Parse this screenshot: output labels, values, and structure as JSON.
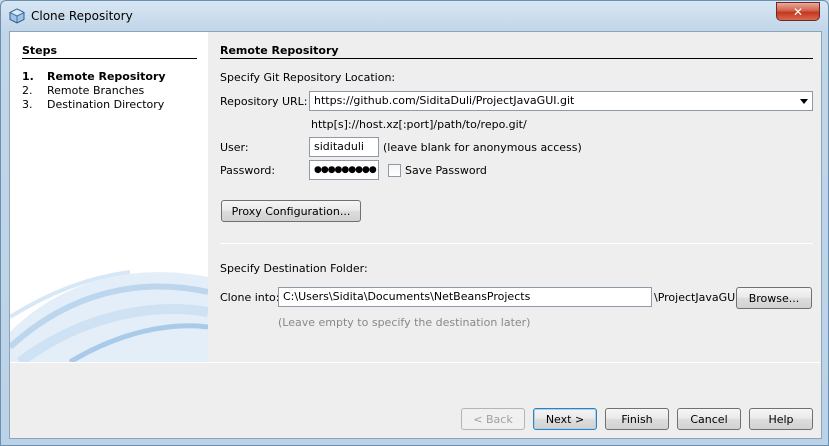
{
  "window": {
    "title": "Clone Repository",
    "close_glyph": "✕"
  },
  "steps": {
    "title": "Steps",
    "items": [
      {
        "num": "1.",
        "label": "Remote Repository",
        "current": true
      },
      {
        "num": "2.",
        "label": "Remote Branches",
        "current": false
      },
      {
        "num": "3.",
        "label": "Destination Directory",
        "current": false
      }
    ]
  },
  "panel": {
    "title": "Remote Repository",
    "specify_location": "Specify Git Repository Location:",
    "repo_url_label": "Repository URL:",
    "repo_url_value": "https://github.com/SiditaDuli/ProjectJavaGUI.git",
    "repo_url_hint": "http[s]://host.xz[:port]/path/to/repo.git/",
    "user_label": "User:",
    "user_value": "siditaduli",
    "user_hint": "(leave blank for anonymous access)",
    "password_label": "Password:",
    "password_value": "●●●●●●●●●",
    "save_password_label": "Save Password",
    "proxy_button": "Proxy Configuration...",
    "specify_destination": "Specify Destination Folder:",
    "clone_into_label": "Clone into:",
    "clone_into_value": "C:\\Users\\Sidita\\Documents\\NetBeansProjects",
    "clone_into_suffix": "\\ProjectJavaGUI",
    "browse_button": "Browse...",
    "clone_into_hint": "(Leave empty to specify the destination later)"
  },
  "buttons": {
    "back": "< Back",
    "next": "Next >",
    "finish": "Finish",
    "cancel": "Cancel",
    "help": "Help"
  }
}
